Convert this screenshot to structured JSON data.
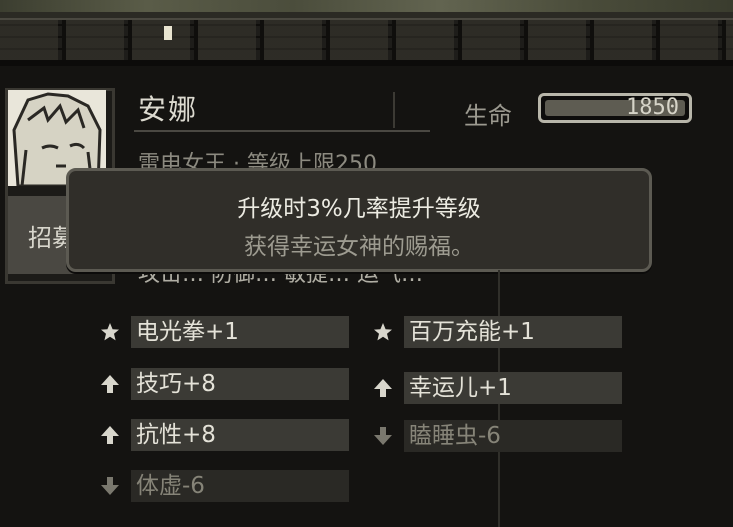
{
  "character": {
    "name": "安娜",
    "hp_label": "生命",
    "hp_value": "1850",
    "hp_fill_fraction": 0.98,
    "sub_info": "雷电女王 · 等级上限250",
    "sub_info2": "攻击…  防御…  敏捷…  运气…",
    "recruit_label": "招募"
  },
  "tooltip": {
    "title": "升级时3%几率提升等级",
    "description": "获得幸运女神的赐福。"
  },
  "traits": {
    "left": [
      {
        "label": "电光拳+1",
        "icon": "star-icon",
        "state": "positive"
      },
      {
        "label": "技巧+8",
        "icon": "arrow-up-icon",
        "state": "positive"
      },
      {
        "label": "抗性+8",
        "icon": "arrow-up-icon",
        "state": "positive"
      },
      {
        "label": "体虚-6",
        "icon": "arrow-down-icon",
        "state": "negative"
      }
    ],
    "right": [
      {
        "label": "百万充能+1",
        "icon": "star-icon",
        "state": "positive"
      },
      {
        "label": "幸运儿+1",
        "icon": "arrow-up-icon",
        "state": "positive"
      },
      {
        "label": "瞌睡虫-6",
        "icon": "arrow-down-icon",
        "state": "negative"
      }
    ]
  },
  "colors": {
    "background": "#141311",
    "trait_box": "#3b3a35",
    "positive_text": "#e4e2d8",
    "negative_text": "#868478"
  }
}
